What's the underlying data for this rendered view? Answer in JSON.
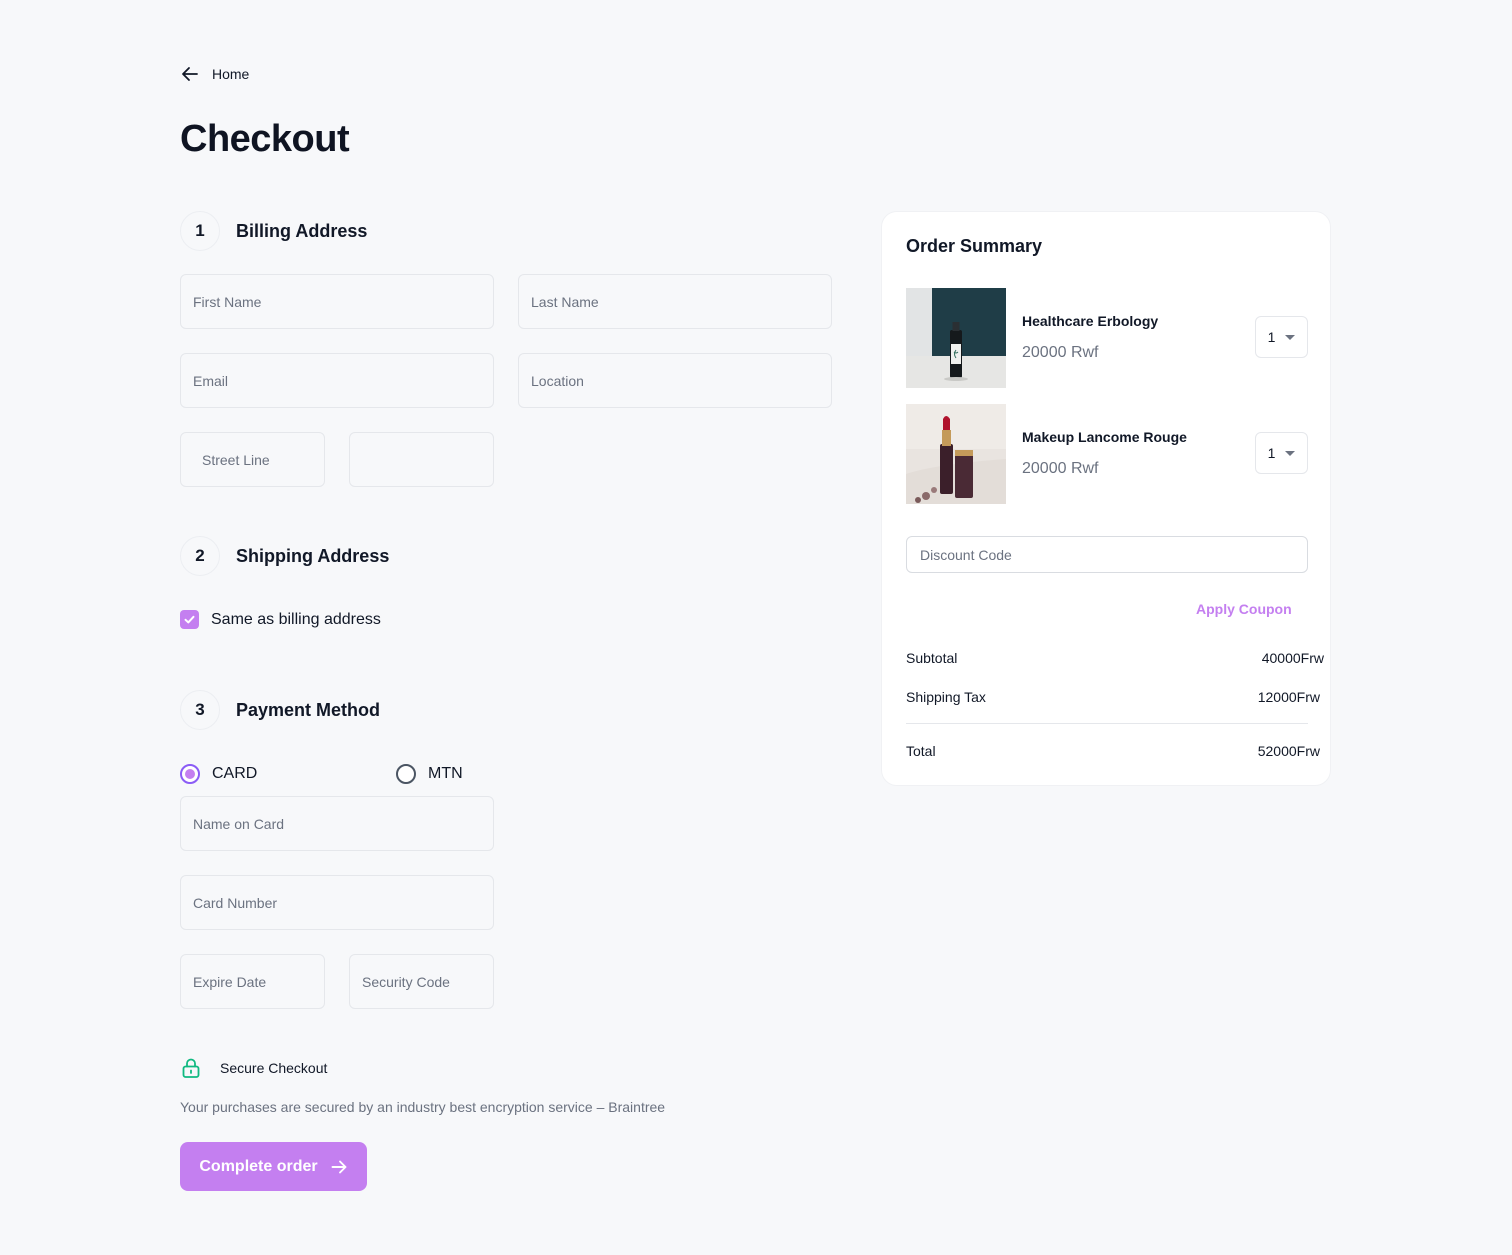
{
  "nav": {
    "back_label": "Home"
  },
  "page": {
    "title": "Checkout"
  },
  "billing": {
    "step": "1",
    "title": "Billing Address",
    "first_name_placeholder": "First Name",
    "last_name_placeholder": "Last Name",
    "email_placeholder": "Email",
    "location_placeholder": "Location",
    "street_line_placeholder": "Street Line",
    "street_line_2_placeholder": ""
  },
  "shipping": {
    "step": "2",
    "title": "Shipping Address",
    "same_as_billing_label": "Same as billing address",
    "same_as_billing_checked": true
  },
  "payment": {
    "step": "3",
    "title": "Payment Method",
    "options": [
      {
        "label": "CARD",
        "selected": true
      },
      {
        "label": "MTN",
        "selected": false
      }
    ],
    "name_on_card_placeholder": "Name on Card",
    "card_number_placeholder": "Card Number",
    "expire_date_placeholder": "Expire Date",
    "security_code_placeholder": "Security Code"
  },
  "secure": {
    "title": "Secure Checkout",
    "note": "Your purchases are secured by an industry best encryption service – Braintree"
  },
  "actions": {
    "complete_label": "Complete order"
  },
  "summary": {
    "title": "Order Summary",
    "items": [
      {
        "name": "Healthcare Erbology",
        "price": "20000 Rwf",
        "qty": "1"
      },
      {
        "name": "Makeup Lancome Rouge",
        "price": "20000 Rwf",
        "qty": "1"
      }
    ],
    "discount_placeholder": "Discount Code",
    "apply_label": "Apply Coupon",
    "subtotal_label": "Subtotal",
    "subtotal_value": "40000Frw",
    "shipping_label": "Shipping Tax",
    "shipping_value": "12000Frw",
    "total_label": "Total",
    "total_value": "52000Frw"
  },
  "colors": {
    "accent": "#c47ff0",
    "radio_ring": "#8b5cf6",
    "secure_icon": "#10b981",
    "background": "#f7f8fa"
  }
}
